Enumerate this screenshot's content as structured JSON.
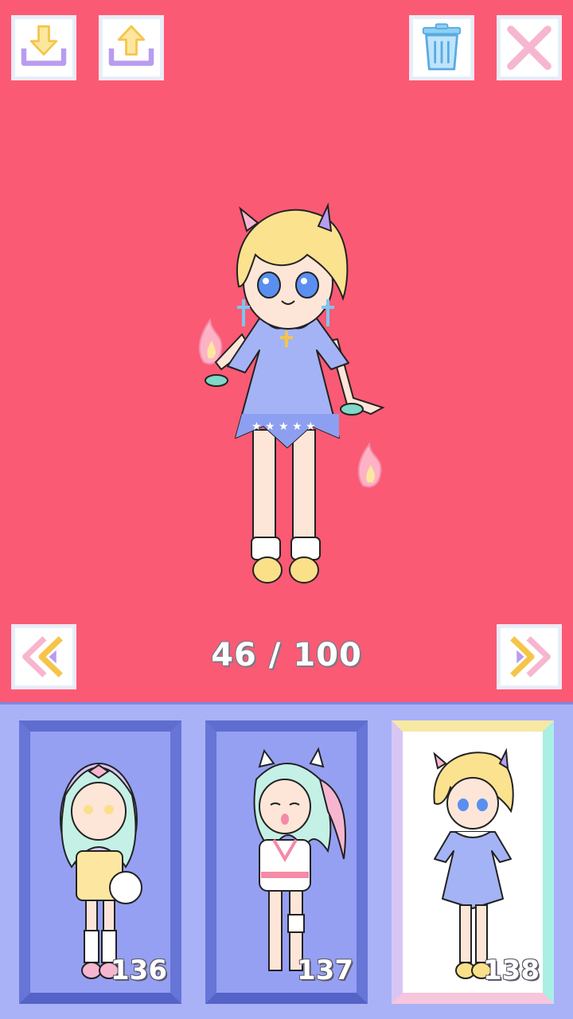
{
  "app": {
    "counter": "46 / 100"
  },
  "toolbar": {
    "download_icon": "download-icon",
    "upload_icon": "upload-icon",
    "trash_icon": "trash-icon",
    "close_icon": "close-icon"
  },
  "navigation": {
    "prev_icon": "double-chevron-left-icon",
    "next_icon": "double-chevron-right-icon"
  },
  "slots": [
    {
      "number": "136",
      "selected": false
    },
    {
      "number": "137",
      "selected": false
    },
    {
      "number": "138",
      "selected": true
    }
  ],
  "colors": {
    "background": "#fa5a74",
    "panel": "#a9b2f7",
    "card_frame": "#6675d6",
    "accent_yellow": "#f5c54a",
    "accent_purple": "#b79cf0"
  }
}
